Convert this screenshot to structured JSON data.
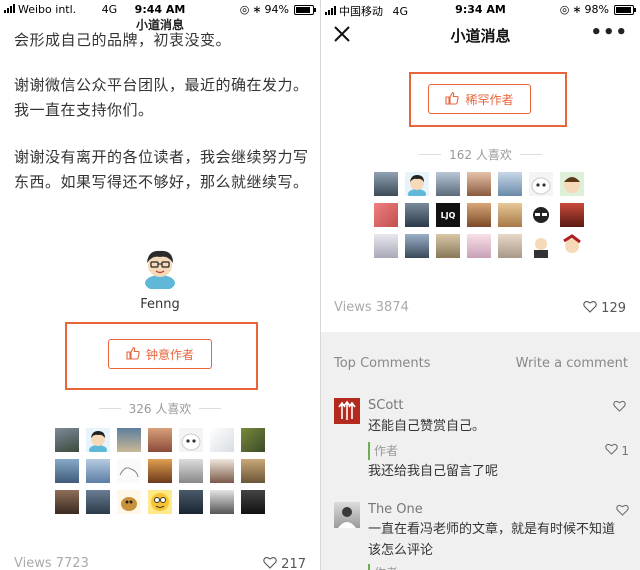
{
  "left": {
    "status": {
      "carrier": "Weibo intl.",
      "network": "4G",
      "time": "9:44 AM",
      "battery": "94%",
      "battery_level": 0.94
    },
    "nav_title": "小道消息",
    "article": {
      "line0": "会形成自己的品牌，初衷没变。",
      "para1": "谢谢微信公众平台团队，最近的确在发力。我一直在支持你们。",
      "para2": "谢谢没有离开的各位读者，我会继续努力写东西。如果写得还不够好，那么就继续写。"
    },
    "author_name": "Fenng",
    "reward_label": "钟意作者",
    "likes_label": "326 人喜欢",
    "views": "Views 7723",
    "like_count": "217"
  },
  "right": {
    "status": {
      "carrier": "中国移动",
      "network": "4G",
      "time": "9:34 AM",
      "battery": "98%",
      "battery_level": 0.98
    },
    "nav_title": "小道消息",
    "more_label": "•••",
    "reward_label": "稀罕作者",
    "likes_label": "162 人喜欢",
    "avatar_badge": "LJQ",
    "views": "Views 3874",
    "like_count": "129",
    "comments_header": "Top Comments",
    "write_comment": "Write a comment",
    "comments": [
      {
        "name": "SCott",
        "text": "还能自己赞赏自己。",
        "like": "",
        "reply_author": "作者",
        "reply_like": "1",
        "reply_text": "我还给我自己留言了呢"
      },
      {
        "name": "The One",
        "text": "一直在看冯老师的文章，就是有时候不知道该怎么评论",
        "like": "",
        "reply_author": "作者"
      }
    ]
  },
  "colors": {
    "accent": "#e8643a",
    "reply_bar": "#6ab04c",
    "comment_bg": "#f0f0f0"
  }
}
